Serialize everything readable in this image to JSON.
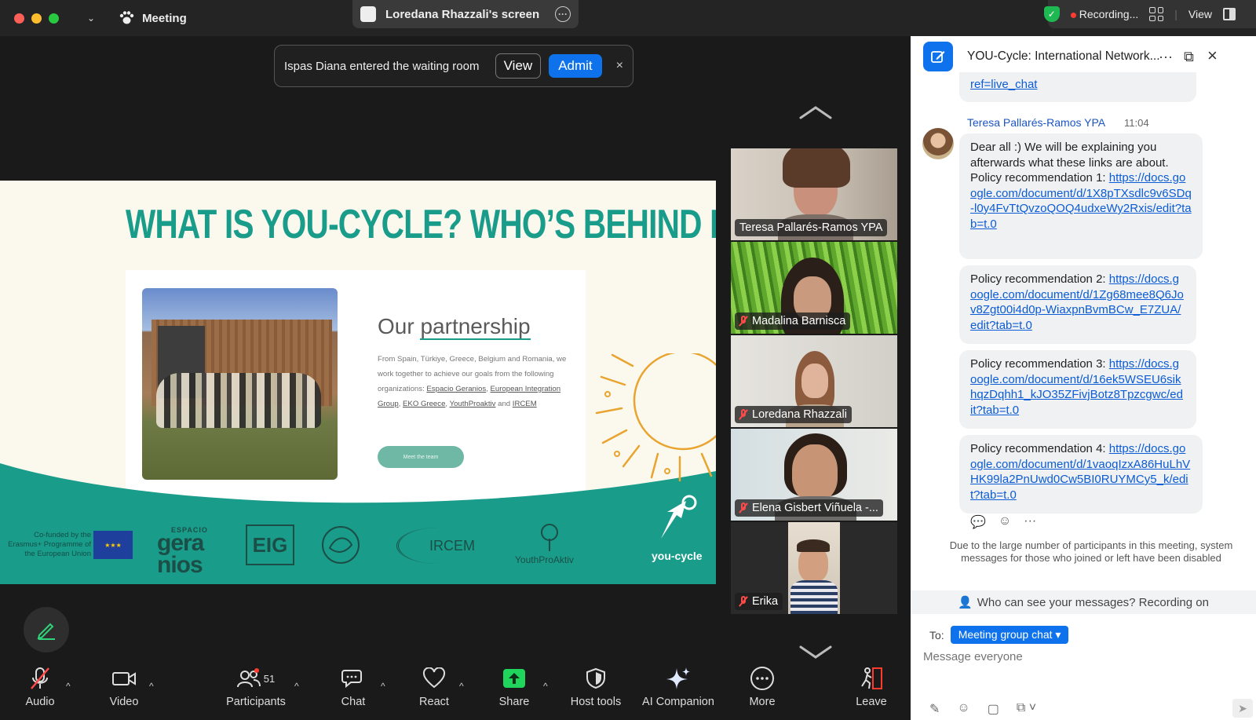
{
  "titlebar": {
    "app_name": "Meeting",
    "share_label": "Loredana Rhazzali's screen",
    "recording_label": "Recording...",
    "view_label": "View"
  },
  "notice": {
    "text": "Ispas Diana entered the waiting room",
    "view_label": "View",
    "admit_label": "Admit",
    "close": "×"
  },
  "slide": {
    "title": "WHAT IS YOU-CYCLE? WHO’S BEHIND IT?",
    "subtitle_pre": "Our ",
    "subtitle_ul": "partnership",
    "text_1": "From Spain, Türkiye, Greece, Belgium and Romania, we work together to achieve our goals from the following organizations: ",
    "org_1": "Espacio Geranios",
    "org_2": "European Integration Group",
    "org_3": "EKO Greece",
    "org_4": "YouthProaktiv",
    "and": " and ",
    "org_5": "IRCEM",
    "button": "Meet the team",
    "eu_text": "Co-funded by the Erasmus+ Programme of the European Union",
    "logo_geranios_top": "ESPACIO",
    "logo_geranios": "gera nios",
    "logo_eig": "EIG",
    "logo_ircem": "IRCEM",
    "logo_ypa": "YouthProAktiv",
    "logo_yc": "you-cycle"
  },
  "gallery": [
    {
      "name": "Teresa Pallarés-Ramos YPA",
      "muted": false,
      "active": true
    },
    {
      "name": "Madalina Barnisca",
      "muted": true,
      "active": false
    },
    {
      "name": "Loredana Rhazzali",
      "muted": true,
      "active": false
    },
    {
      "name": "Elena Gisbert Viñuela -...",
      "muted": true,
      "active": false
    },
    {
      "name": "Erika",
      "muted": true,
      "active": false
    }
  ],
  "toolbar": {
    "audio": "Audio",
    "video": "Video",
    "participants": "Participants",
    "participants_count": "51",
    "chat": "Chat",
    "react": "React",
    "share": "Share",
    "host_tools": "Host tools",
    "ai_companion": "AI Companion",
    "more": "More",
    "leave": "Leave"
  },
  "chat": {
    "title": "YOU-Cycle: International Network...",
    "prev_link": "ref=live_chat",
    "sender": "Teresa Pallarés-Ramos YPA",
    "time": "11:04",
    "msg1_text": "Dear all :) We will be explaining you afterwards what these links are about.",
    "msg1_label": "Policy recommendation 1: ",
    "msg1_link": "https://docs.google.com/document/d/1X8pTXsdlc9v6SDq-l0y4FvTtQvzoQOQ4udxeWy2Rxis/edit?tab=t.0",
    "msg2_label": "Policy recommendation 2: ",
    "msg2_link": "https://docs.google.com/document/d/1Zg68mee8Q6Jov8Zgt00i4d0p-WiaxpnBvmBCw_E7ZUA/edit?tab=t.0",
    "msg3_label": "Policy recommendation 3: ",
    "msg3_link": "https://docs.google.com/document/d/16ek5WSEU6sikhqzDqhh1_kJO35ZFivjBotz8Tpzcgwc/edit?tab=t.0",
    "msg4_label": "Policy recommendation 4: ",
    "msg4_link": "https://docs.google.com/document/d/1vaoqIzxA86HuLhVHK99la2PnUwd0Cw5BI0RUYMCy5_k/edit?tab=t.0",
    "system_note": "Due to the large number of participants in this meeting, system messages for those who joined or left have been disabled",
    "who_can_see": "Who can see your messages? Recording on",
    "to_label": "To:",
    "to_value": "Meeting group chat",
    "input_placeholder": "Message everyone"
  },
  "colors": {
    "accent": "#0e72ed",
    "teal": "#1a9c8a",
    "active_speaker": "#23d959",
    "muted_red": "#ff4a4a"
  }
}
